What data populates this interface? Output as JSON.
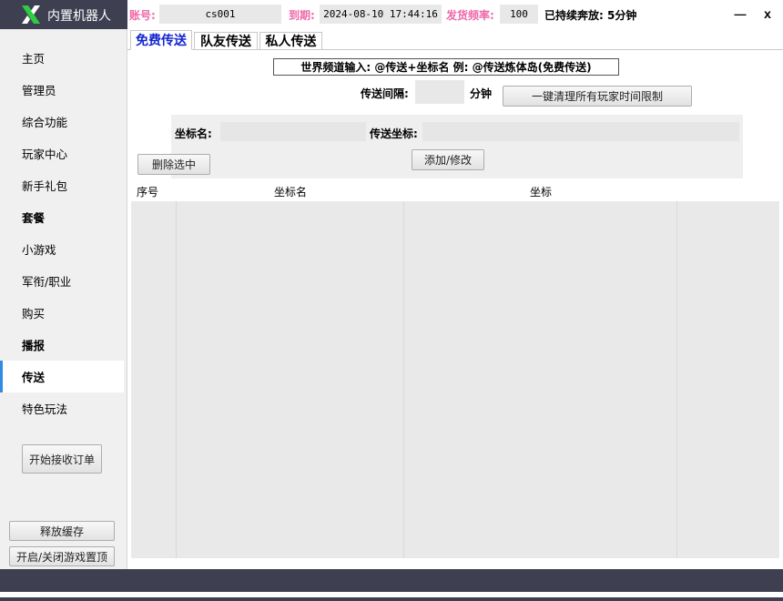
{
  "app": {
    "name": "内置机器人",
    "logo_icon": "x-logo-icon"
  },
  "topbar": {
    "account_label": "账号:",
    "account_value": "cs001",
    "expire_label": "到期:",
    "expire_value": "2024-08-10 17:44:16",
    "freq_label": "发货频率:",
    "freq_value": "100",
    "status": "已持续奔放: 5分钟",
    "minimize": "—",
    "close": "x"
  },
  "sidebar": {
    "items": [
      {
        "label": "主页"
      },
      {
        "label": "管理员"
      },
      {
        "label": "综合功能"
      },
      {
        "label": "玩家中心"
      },
      {
        "label": "新手礼包"
      },
      {
        "label": "套餐"
      },
      {
        "label": "小游戏"
      },
      {
        "label": "军衔/职业"
      },
      {
        "label": "购买"
      },
      {
        "label": "播报"
      },
      {
        "label": "传送"
      },
      {
        "label": "特色玩法"
      }
    ],
    "active_index": 10,
    "start_orders_button": "开始接收订单",
    "release_cache_button": "释放缓存",
    "toggle_top_button": "开启/关闭游戏置顶"
  },
  "tabs": [
    "免费传送",
    "队友传送",
    "私人传送"
  ],
  "main": {
    "hint": "世界频道输入: @传送+坐标名 例: @传送炼体岛(免费传送)",
    "interval_label": "传送间隔:",
    "interval_value": "",
    "interval_unit": "分钟",
    "clear_limit_button": "一键清理所有玩家时间限制",
    "coord_name_label": "坐标名:",
    "coord_name_value": "",
    "coord_value_label": "传送坐标:",
    "coord_value_value": "",
    "delete_button": "删除选中",
    "add_modify_button": "添加/修改"
  },
  "table": {
    "columns": [
      "序号",
      "坐标名",
      "坐标"
    ],
    "rows": []
  },
  "colors": {
    "dark_bar": "#3e4052",
    "pink_label": "#ee6aa9",
    "active_tab": "#1326d0",
    "active_nav_accent": "#2f8be6",
    "logo_green": "#2ecc40"
  }
}
